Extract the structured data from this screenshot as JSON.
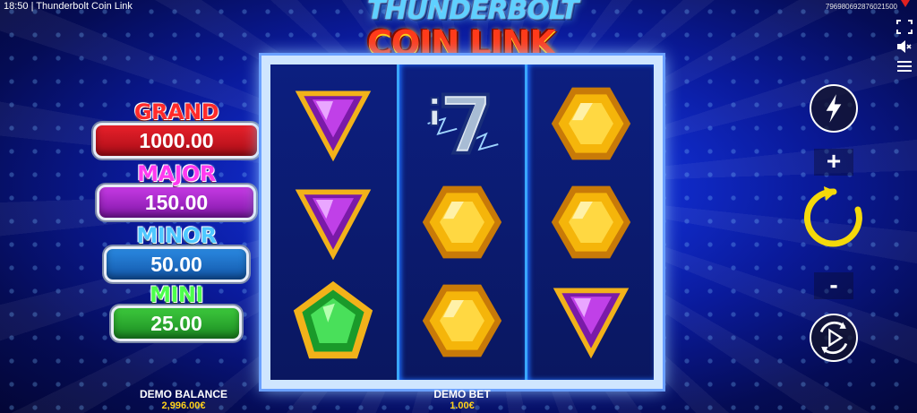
{
  "status": {
    "time_title": "18:50 | Thunderbolt Coin Link",
    "session_id": "796980692876021500"
  },
  "logo": {
    "line1": "THUNDERBOLT",
    "line2": "COIN LINK"
  },
  "jackpots": [
    {
      "name": "GRAND",
      "value": "1000.00",
      "color": "#e8202a"
    },
    {
      "name": "MAJOR",
      "value": "150.00",
      "color": "#c63ae4"
    },
    {
      "name": "MINOR",
      "value": "50.00",
      "color": "#2a88e0"
    },
    {
      "name": "MINI",
      "value": "25.00",
      "color": "#3cc83c"
    }
  ],
  "reels": [
    [
      "purple-triangle-gem",
      "purple-triangle-gem",
      "green-pentagon-gem"
    ],
    [
      "lucky-seven",
      "gold-hexagon-gem",
      "gold-hexagon-gem"
    ],
    [
      "gold-hexagon-gem",
      "gold-hexagon-gem",
      "purple-triangle-gem"
    ]
  ],
  "controls": {
    "turbo_icon": "lightning-icon",
    "plus": "+",
    "minus": "-",
    "spin_icon": "spin-arrow-icon",
    "autoplay_icon": "autoplay-icon",
    "spin_color": "#f5d90a"
  },
  "footer": {
    "balance_label": "DEMO BALANCE",
    "balance_value": "2,996.00€",
    "bet_label": "DEMO BET",
    "bet_value": "1.00€"
  }
}
